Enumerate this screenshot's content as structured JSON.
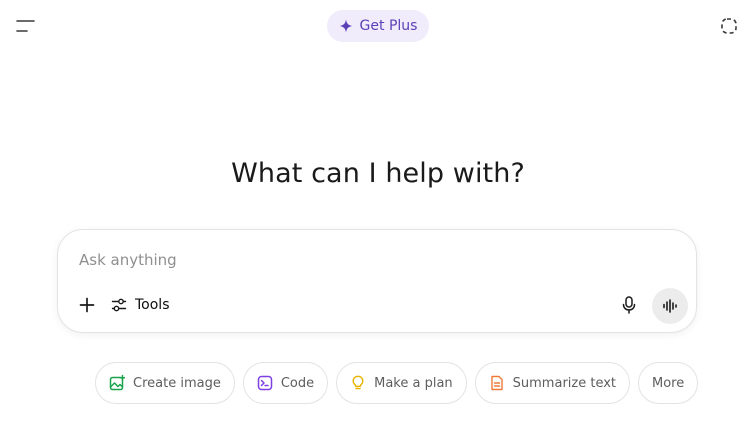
{
  "header": {
    "menu_icon": "sidebar-menu-icon",
    "upgrade_label": "Get Plus",
    "upgrade_icon": "sparkle-icon",
    "upgrade_color": "#5b3fb8",
    "temp_chat_icon": "dashed-circle-icon"
  },
  "main": {
    "headline": "What can I help with?"
  },
  "composer": {
    "placeholder": "Ask anything",
    "value": "",
    "tools_label": "Tools",
    "attach_icon": "plus-icon",
    "tools_icon": "sliders-icon",
    "mic_icon": "microphone-icon",
    "voice_icon": "voice-waveform-icon"
  },
  "suggestions": [
    {
      "label": "Create image",
      "icon": "image-icon",
      "color": "#1aa34a"
    },
    {
      "label": "Code",
      "icon": "terminal-icon",
      "color": "#7e3fe4"
    },
    {
      "label": "Make a plan",
      "icon": "lightbulb-icon",
      "color": "#e8b400"
    },
    {
      "label": "Summarize text",
      "icon": "document-icon",
      "color": "#ef7a3a"
    },
    {
      "label": "More",
      "icon": "",
      "color": ""
    }
  ]
}
